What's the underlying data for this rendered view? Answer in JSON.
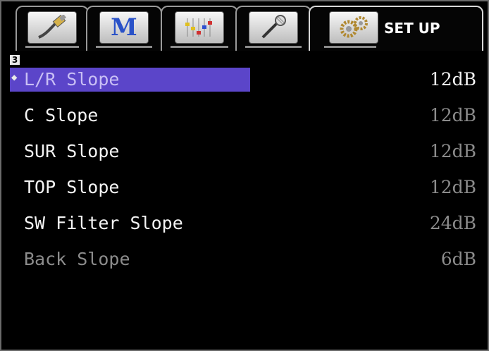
{
  "tabs": [
    {
      "name": "tab-input",
      "icon": "hdmi-cable-icon"
    },
    {
      "name": "tab-mode",
      "icon": "m-letter-icon",
      "glyph": "M"
    },
    {
      "name": "tab-equalizer",
      "icon": "equalizer-sliders-icon"
    },
    {
      "name": "tab-microphone",
      "icon": "microphone-icon"
    },
    {
      "name": "tab-setup",
      "icon": "gears-icon",
      "label": "SET UP",
      "active": true
    }
  ],
  "page_number": "3",
  "settings": [
    {
      "label": "L/R Slope",
      "value": "12dB",
      "selected": true
    },
    {
      "label": "C Slope",
      "value": "12dB"
    },
    {
      "label": "SUR Slope",
      "value": "12dB"
    },
    {
      "label": "TOP Slope",
      "value": "12dB"
    },
    {
      "label": "SW Filter Slope",
      "value": "24dB"
    },
    {
      "label": "Back Slope",
      "value": "6dB",
      "disabled": true
    }
  ],
  "colors": {
    "selection": "#5b45c9",
    "text": "#f4f4f4",
    "dim_text": "#8c8c8c",
    "background": "#000000"
  }
}
